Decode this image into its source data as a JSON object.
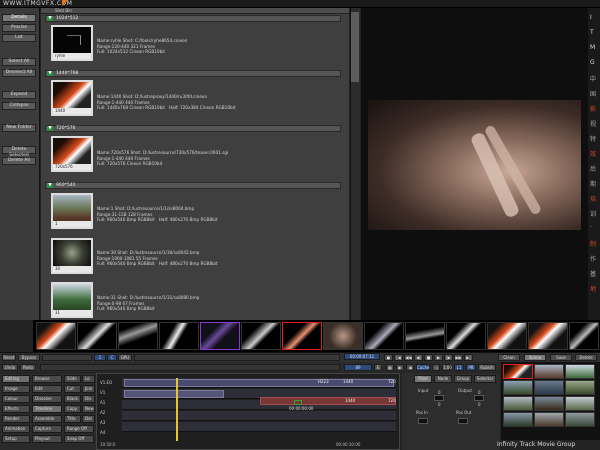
{
  "site_url": "WWW.ITMGVFX.COM",
  "left_buttons": [
    "Details",
    "Proxies",
    "List",
    "Select All",
    "Deselect All",
    "Expand",
    "Collapse",
    "New Folder",
    "Delete Selected",
    "Delete All"
  ],
  "shotlist_header": "Shot Bin",
  "groups": [
    {
      "label": "1024*512",
      "thumb_cap": "ryhle",
      "info": "Name:ryhle Shot: C:/fools/ryhe8654.cineon\nRange:120-440 321 Frames\nFull: 1024x512 Cineon RGB10bit"
    },
    {
      "label": "1440*768",
      "thumb_cap": "1440",
      "info": "Name:1440 Shot: D:/lustreproxy/1440/ru30fd.cineon\nRange:1-440 440 Frames\nFull: 1440x768 Cineon RGB10bit   Half: 720x384 Cineon RGB10bit"
    },
    {
      "label": "720*576",
      "thumb_cap": "720x576",
      "info": "Name:720x576 Shot: D:/lustresource/720x576/teaser.0001.sgi\nRange:1-440 440 Frames\nFull: 720x576 Cineon RGB10bit"
    },
    {
      "label": "960*540",
      "items": [
        {
          "thumb_cap": "1",
          "info": "Name:1 Shot: D:/lustresource/1/1/ss8004.bmp\nRange:31-158 128 Frames\nFull: 960x540 Bmp RGB8bit   Half: 480x270 Bmp RGB8bit"
        },
        {
          "thumb_cap": "30",
          "info": "Name:30 Shot: D:/lustresource/1/30/ss8042.bmp\nRange:1000-1081 55 Frames\nFull: 960x540 Bmp RGB8bit   Half: 480x270 Bmp RGB8bit"
        },
        {
          "thumb_cap": "31",
          "info": "Name:31 Shot: D:/lustresource/1/31/ss8080.bmp\nRange:0-98 67 Frames\nFull: 960x540 Bmp RGB8bit"
        }
      ]
    }
  ],
  "viewer_chars": [
    "I",
    "T",
    "M",
    "G",
    "中",
    "国",
    "影",
    "视",
    "特",
    "效",
    "后",
    "期",
    "培",
    "训",
    "·",
    "制",
    "作",
    "基",
    "地"
  ],
  "tbar": {
    "reset": "Reset",
    "bypass": "Bypass",
    "one": "1",
    "c": "C",
    "gpu": "GPU",
    "timecode": "00:00:07:11",
    "clean": "Clean",
    "scene": "Scene",
    "save": "Save",
    "delete": "Delete",
    "frame": "89",
    "e": "E",
    "value": "1.00",
    "l1": "L1",
    "pb": "PB",
    "cache": "Cache",
    "rubish": "Rubish"
  },
  "tbar2": {
    "undo": "Undo",
    "redo": "Redo"
  },
  "edit_buttons": [
    [
      "Editing",
      "Browse",
      "Slide",
      "Lo"
    ],
    [
      "Image",
      "Edit",
      "Cut",
      "Join"
    ],
    [
      "Colour",
      "Dissolve",
      "Black",
      "Dis"
    ],
    [
      "Effects",
      "Timeline",
      "Copy",
      "New"
    ],
    [
      "Render",
      "Assemble",
      "Title",
      "Del"
    ],
    [
      "Animation",
      "Capture",
      "Range Off",
      ""
    ],
    [
      "Setup",
      "Playout",
      "Snap Off",
      ""
    ]
  ],
  "track_labels": [
    "V1.EO",
    "V1",
    "A1",
    "A2",
    "A3",
    "A4"
  ],
  "timeline_labels": {
    "clip1": "H223",
    "clip2": "1440",
    "clip3": "720",
    "clip4": "1440",
    "clip5": "720",
    "tc_center": "00:00:00:00",
    "tc_left": "10:50:0",
    "tc_right": "00:00:10:00"
  },
  "prop_tabs": [
    "Pixel",
    "Node",
    "Group",
    "Selector"
  ],
  "props": {
    "input": "Input",
    "output": "Output",
    "pos_in": "Pos In",
    "pos_out": "Pos Out",
    "vals": [
      "0",
      "0",
      "0",
      "0"
    ]
  },
  "brand": "Infinity Track Movie Group"
}
